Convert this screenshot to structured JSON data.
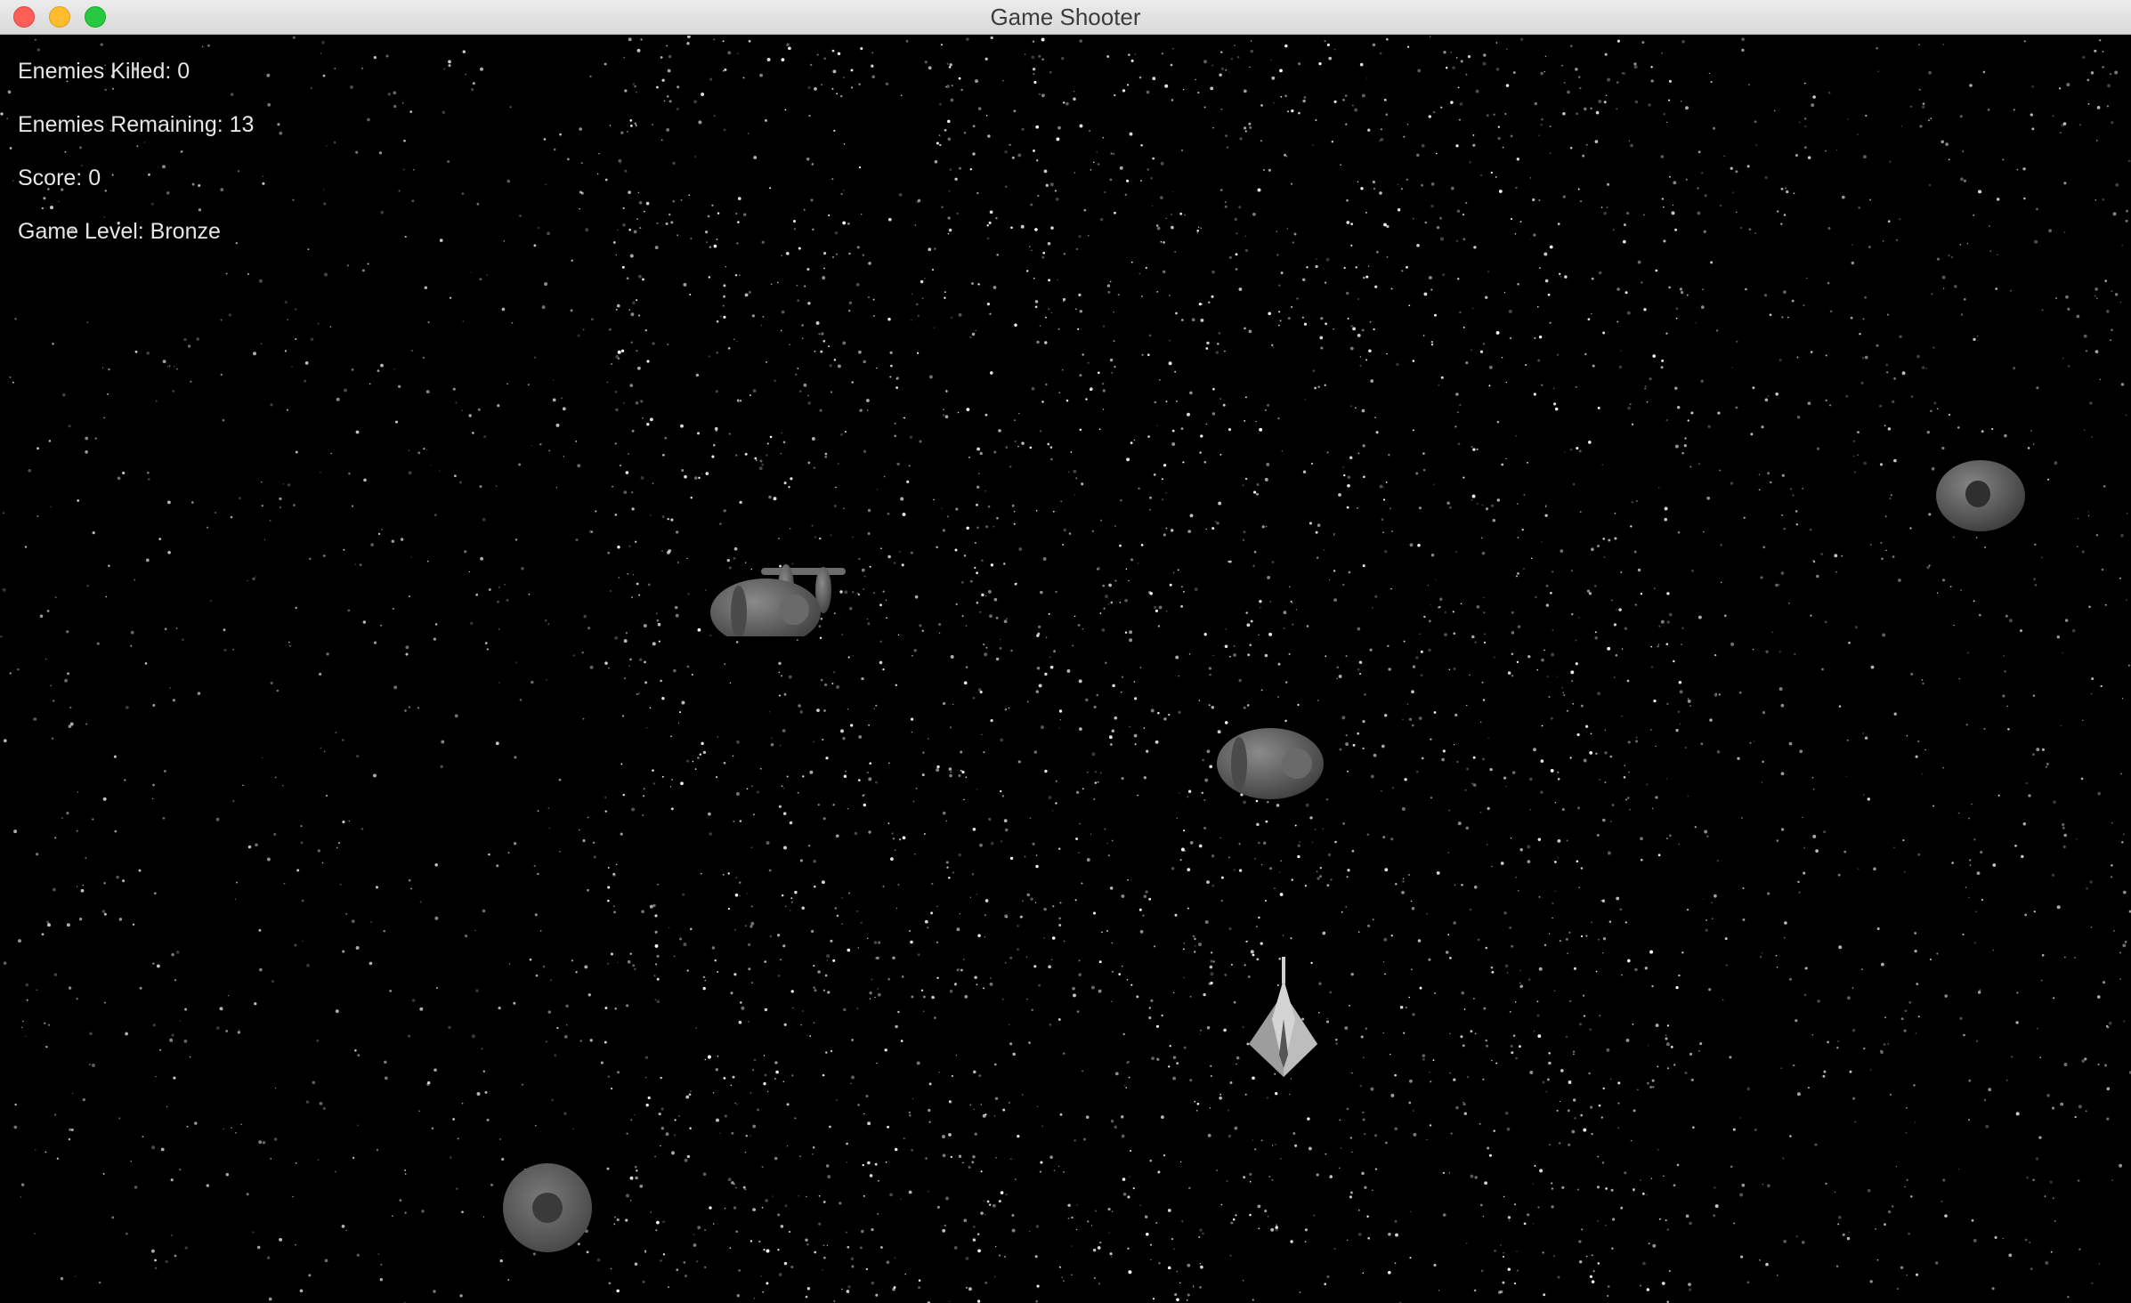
{
  "window": {
    "title": "Game Shooter"
  },
  "hud": {
    "enemies_killed": "Enemies Killed: 0",
    "enemies_remaining": "Enemies Remaining: 13",
    "score": "Score: 0",
    "game_level": "Game Level: Bronze"
  },
  "colors": {
    "background": "#000000",
    "hud_text": "#e6e6e6",
    "enemy_body": "#5a5a5a",
    "player_ship": "#b8b8b8"
  },
  "sprites": {
    "player": "player-ship",
    "enemies": [
      "enemy-plane",
      "enemy-pod",
      "enemy-pod",
      "enemy-disc"
    ]
  }
}
